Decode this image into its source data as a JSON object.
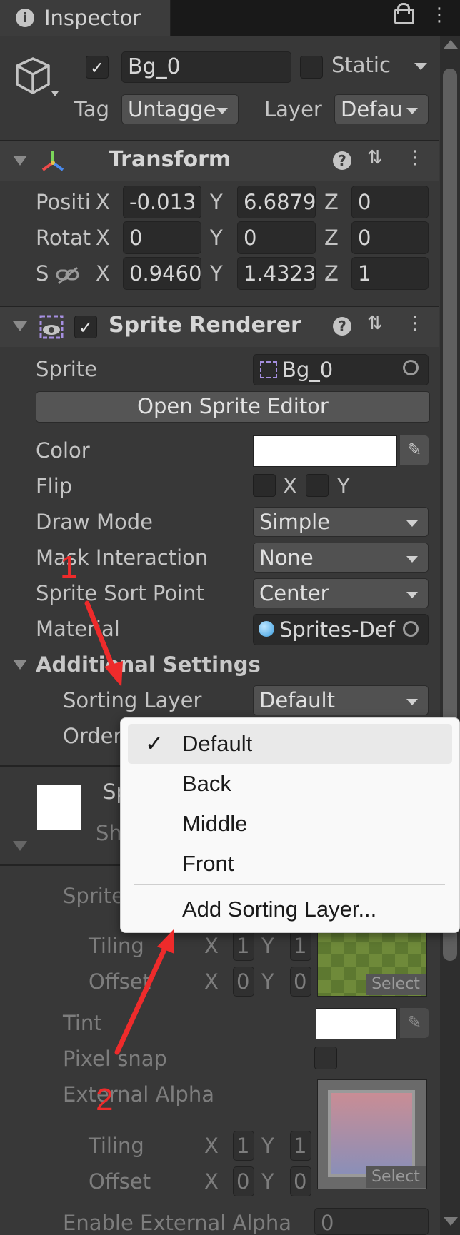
{
  "tab": {
    "title": "Inspector",
    "info_icon": "info-icon"
  },
  "object": {
    "active": "✓",
    "name": "Bg_0",
    "static_label": "Static",
    "tag_label": "Tag",
    "tag_value": "Untagge",
    "layer_label": "Layer",
    "layer_value": "Defau"
  },
  "transform": {
    "title": "Transform",
    "rows": [
      {
        "label": "Positi",
        "x": "-0.013",
        "y": "6.6879",
        "z": "0"
      },
      {
        "label": "Rotat",
        "x": "0",
        "y": "0",
        "z": "0"
      },
      {
        "label": "S",
        "x": "0.9460",
        "y": "1.4323",
        "z": "1"
      }
    ],
    "axis": {
      "x": "X",
      "y": "Y",
      "z": "Z"
    }
  },
  "sprite_renderer": {
    "check": "✓",
    "title": "Sprite Renderer",
    "sprite_label": "Sprite",
    "sprite_value": "Bg_0",
    "open_editor": "Open Sprite Editor",
    "color_label": "Color",
    "flip_label": "Flip",
    "flip_x": "X",
    "flip_y": "Y",
    "draw_mode_label": "Draw Mode",
    "draw_mode_value": "Simple",
    "mask_label": "Mask Interaction",
    "mask_value": "None",
    "sort_point_label": "Sprite Sort Point",
    "sort_point_value": "Center",
    "material_label": "Material",
    "material_value": "Sprites-Def",
    "additional_label": "Additional Settings",
    "sorting_layer_label": "Sorting Layer",
    "sorting_layer_value": "Default",
    "order_label": "Order"
  },
  "material_section": {
    "partial_title": "Sp",
    "partial_shader": "Sh",
    "sprite_label": "Sprite",
    "tiling_label": "Tiling",
    "offset_label": "Offset",
    "tiling_x": "1",
    "tiling_y": "1",
    "offset_x": "0",
    "offset_y": "0",
    "x_label": "X",
    "y_label": "Y",
    "select_label": "Select",
    "tint_label": "Tint",
    "pixel_snap_label": "Pixel snap",
    "external_alpha_label": "External Alpha",
    "ea_tiling_x": "1",
    "ea_tiling_y": "1",
    "ea_offset_x": "0",
    "ea_offset_y": "0",
    "enable_external_alpha_label": "Enable External Alpha",
    "enable_external_alpha_value": "0"
  },
  "dropdown_menu": {
    "items": [
      "Default",
      "Back",
      "Middle",
      "Front"
    ],
    "selected_mark": "✓",
    "add_label": "Add Sorting Layer..."
  },
  "annotations": {
    "one": "1",
    "two": "2"
  },
  "colors": {
    "annotation_red": "#ee2b2b",
    "panel_bg": "#383838"
  }
}
